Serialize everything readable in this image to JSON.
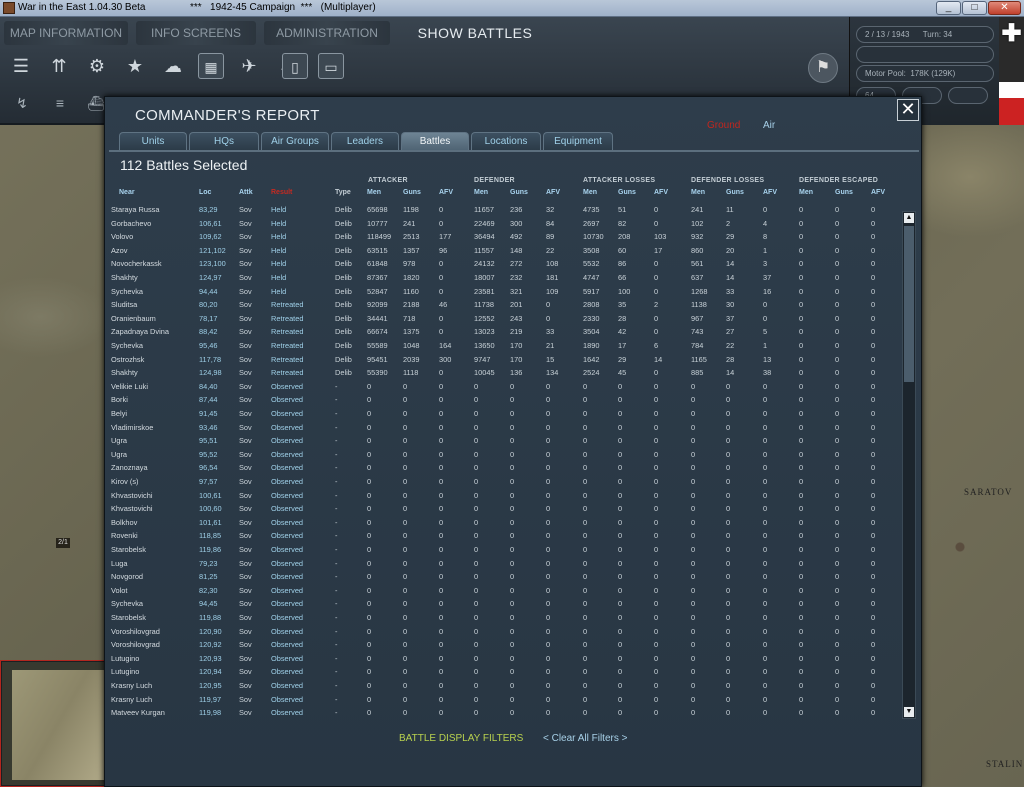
{
  "window": {
    "title": "War in the East 1.04.30 Beta",
    "subtitle": "***   1942-45 Campaign  ***   (Multiplayer)",
    "min": "_",
    "max": "□",
    "close": "✕"
  },
  "nav": {
    "map_information": "MAP INFORMATION",
    "info_screens": "INFO SCREENS",
    "administration": "ADMINISTRATION",
    "show_battles": "SHOW BATTLES"
  },
  "status": {
    "date": "2 / 13 / 1943",
    "turn": "Turn: 34",
    "motor_pool": "Motor Pool:  178K (129K)",
    "speed": "64"
  },
  "map_labels": {
    "saratov": "SARATOV",
    "stalingrad": "STALIN",
    "hex_counter": "2/1"
  },
  "dialog": {
    "title": "COMMANDER'S REPORT",
    "close_icon": "✕",
    "filter_ground": "Ground",
    "filter_air": "Air",
    "tabs": [
      "Units",
      "HQs",
      "Air Groups",
      "Leaders",
      "Battles",
      "Locations",
      "Equipment"
    ],
    "active_tab": "Battles",
    "count_text": "112 Battles Selected",
    "groups": {
      "attacker": "ATTACKER",
      "defender": "DEFENDER",
      "attacker_losses": "ATTACKER LOSSES",
      "defender_losses": "DEFENDER LOSSES",
      "defender_escaped": "DEFENDER ESCAPED"
    },
    "columns": {
      "near": "Near",
      "loc": "Loc",
      "attk": "Attk",
      "result": "Result",
      "type": "Type",
      "men": "Men",
      "guns": "Guns",
      "afv": "AFV"
    },
    "footer_filters": "BATTLE DISPLAY FILTERS",
    "footer_clear": "< Clear All Filters >",
    "colors": {
      "accent_blue": "#9fd0e8",
      "result_red": "#c42a22",
      "filter_green": "#b8d14f"
    }
  },
  "battles": [
    [
      "Staraya Russa",
      "83,29",
      "Sov",
      "Held",
      "Delib",
      "65698",
      "1198",
      "0",
      "11657",
      "236",
      "32",
      "4735",
      "51",
      "0",
      "241",
      "11",
      "0",
      "0",
      "0",
      "0"
    ],
    [
      "Gorbachevo",
      "106,61",
      "Sov",
      "Held",
      "Delib",
      "10777",
      "241",
      "0",
      "22469",
      "300",
      "84",
      "2697",
      "82",
      "0",
      "102",
      "2",
      "4",
      "0",
      "0",
      "0"
    ],
    [
      "Volovo",
      "109,62",
      "Sov",
      "Held",
      "Delib",
      "118499",
      "2513",
      "177",
      "36494",
      "492",
      "89",
      "10730",
      "208",
      "103",
      "932",
      "29",
      "8",
      "0",
      "0",
      "0"
    ],
    [
      "Azov",
      "121,102",
      "Sov",
      "Held",
      "Delib",
      "63515",
      "1357",
      "96",
      "11557",
      "148",
      "22",
      "3508",
      "60",
      "17",
      "860",
      "20",
      "1",
      "0",
      "0",
      "0"
    ],
    [
      "Novocherkassk",
      "123,100",
      "Sov",
      "Held",
      "Delib",
      "61848",
      "978",
      "0",
      "24132",
      "272",
      "108",
      "5532",
      "86",
      "0",
      "561",
      "14",
      "3",
      "0",
      "0",
      "0"
    ],
    [
      "Shakhty",
      "124,97",
      "Sov",
      "Held",
      "Delib",
      "87367",
      "1820",
      "0",
      "18007",
      "232",
      "181",
      "4747",
      "66",
      "0",
      "637",
      "14",
      "37",
      "0",
      "0",
      "0"
    ],
    [
      "Sychevka",
      "94,44",
      "Sov",
      "Held",
      "Delib",
      "52847",
      "1160",
      "0",
      "23581",
      "321",
      "109",
      "5917",
      "100",
      "0",
      "1268",
      "33",
      "16",
      "0",
      "0",
      "0"
    ],
    [
      "Sluditsa",
      "80,20",
      "Sov",
      "Retreated",
      "Delib",
      "92099",
      "2188",
      "46",
      "11738",
      "201",
      "0",
      "2808",
      "35",
      "2",
      "1138",
      "30",
      "0",
      "0",
      "0",
      "0"
    ],
    [
      "Oranienbaum",
      "78,17",
      "Sov",
      "Retreated",
      "Delib",
      "34441",
      "718",
      "0",
      "12552",
      "243",
      "0",
      "2330",
      "28",
      "0",
      "967",
      "37",
      "0",
      "0",
      "0",
      "0"
    ],
    [
      "Zapadnaya Dvina",
      "88,42",
      "Sov",
      "Retreated",
      "Delib",
      "66674",
      "1375",
      "0",
      "13023",
      "219",
      "33",
      "3504",
      "42",
      "0",
      "743",
      "27",
      "5",
      "0",
      "0",
      "0"
    ],
    [
      "Sychevka",
      "95,46",
      "Sov",
      "Retreated",
      "Delib",
      "55589",
      "1048",
      "164",
      "13650",
      "170",
      "21",
      "1890",
      "17",
      "6",
      "784",
      "22",
      "1",
      "0",
      "0",
      "0"
    ],
    [
      "Ostrozhsk",
      "117,78",
      "Sov",
      "Retreated",
      "Delib",
      "95451",
      "2039",
      "300",
      "9747",
      "170",
      "15",
      "1642",
      "29",
      "14",
      "1165",
      "28",
      "13",
      "0",
      "0",
      "0"
    ],
    [
      "Shakhty",
      "124,98",
      "Sov",
      "Retreated",
      "Delib",
      "55390",
      "1118",
      "0",
      "10045",
      "136",
      "134",
      "2524",
      "45",
      "0",
      "885",
      "14",
      "38",
      "0",
      "0",
      "0"
    ],
    [
      "Velikie Luki",
      "84,40",
      "Sov",
      "Observed",
      "-",
      "0",
      "0",
      "0",
      "0",
      "0",
      "0",
      "0",
      "0",
      "0",
      "0",
      "0",
      "0",
      "0",
      "0",
      "0"
    ],
    [
      "Borki",
      "87,44",
      "Sov",
      "Observed",
      "-",
      "0",
      "0",
      "0",
      "0",
      "0",
      "0",
      "0",
      "0",
      "0",
      "0",
      "0",
      "0",
      "0",
      "0",
      "0"
    ],
    [
      "Belyi",
      "91,45",
      "Sov",
      "Observed",
      "-",
      "0",
      "0",
      "0",
      "0",
      "0",
      "0",
      "0",
      "0",
      "0",
      "0",
      "0",
      "0",
      "0",
      "0",
      "0"
    ],
    [
      "Vladimirskoe",
      "93,46",
      "Sov",
      "Observed",
      "-",
      "0",
      "0",
      "0",
      "0",
      "0",
      "0",
      "0",
      "0",
      "0",
      "0",
      "0",
      "0",
      "0",
      "0",
      "0"
    ],
    [
      "Ugra",
      "95,51",
      "Sov",
      "Observed",
      "-",
      "0",
      "0",
      "0",
      "0",
      "0",
      "0",
      "0",
      "0",
      "0",
      "0",
      "0",
      "0",
      "0",
      "0",
      "0"
    ],
    [
      "Ugra",
      "95,52",
      "Sov",
      "Observed",
      "-",
      "0",
      "0",
      "0",
      "0",
      "0",
      "0",
      "0",
      "0",
      "0",
      "0",
      "0",
      "0",
      "0",
      "0",
      "0"
    ],
    [
      "Zanoznaya",
      "96,54",
      "Sov",
      "Observed",
      "-",
      "0",
      "0",
      "0",
      "0",
      "0",
      "0",
      "0",
      "0",
      "0",
      "0",
      "0",
      "0",
      "0",
      "0",
      "0"
    ],
    [
      "Kirov (s)",
      "97,57",
      "Sov",
      "Observed",
      "-",
      "0",
      "0",
      "0",
      "0",
      "0",
      "0",
      "0",
      "0",
      "0",
      "0",
      "0",
      "0",
      "0",
      "0",
      "0"
    ],
    [
      "Khvastovichi",
      "100,61",
      "Sov",
      "Observed",
      "-",
      "0",
      "0",
      "0",
      "0",
      "0",
      "0",
      "0",
      "0",
      "0",
      "0",
      "0",
      "0",
      "0",
      "0",
      "0"
    ],
    [
      "Khvastovichi",
      "100,60",
      "Sov",
      "Observed",
      "-",
      "0",
      "0",
      "0",
      "0",
      "0",
      "0",
      "0",
      "0",
      "0",
      "0",
      "0",
      "0",
      "0",
      "0",
      "0"
    ],
    [
      "Bolkhov",
      "101,61",
      "Sov",
      "Observed",
      "-",
      "0",
      "0",
      "0",
      "0",
      "0",
      "0",
      "0",
      "0",
      "0",
      "0",
      "0",
      "0",
      "0",
      "0",
      "0"
    ],
    [
      "Rovenki",
      "118,85",
      "Sov",
      "Observed",
      "-",
      "0",
      "0",
      "0",
      "0",
      "0",
      "0",
      "0",
      "0",
      "0",
      "0",
      "0",
      "0",
      "0",
      "0",
      "0"
    ],
    [
      "Starobelsk",
      "119,86",
      "Sov",
      "Observed",
      "-",
      "0",
      "0",
      "0",
      "0",
      "0",
      "0",
      "0",
      "0",
      "0",
      "0",
      "0",
      "0",
      "0",
      "0",
      "0"
    ],
    [
      "Luga",
      "79,23",
      "Sov",
      "Observed",
      "-",
      "0",
      "0",
      "0",
      "0",
      "0",
      "0",
      "0",
      "0",
      "0",
      "0",
      "0",
      "0",
      "0",
      "0",
      "0"
    ],
    [
      "Novgorod",
      "81,25",
      "Sov",
      "Observed",
      "-",
      "0",
      "0",
      "0",
      "0",
      "0",
      "0",
      "0",
      "0",
      "0",
      "0",
      "0",
      "0",
      "0",
      "0",
      "0"
    ],
    [
      "Volot",
      "82,30",
      "Sov",
      "Observed",
      "-",
      "0",
      "0",
      "0",
      "0",
      "0",
      "0",
      "0",
      "0",
      "0",
      "0",
      "0",
      "0",
      "0",
      "0",
      "0"
    ],
    [
      "Sychevka",
      "94,45",
      "Sov",
      "Observed",
      "-",
      "0",
      "0",
      "0",
      "0",
      "0",
      "0",
      "0",
      "0",
      "0",
      "0",
      "0",
      "0",
      "0",
      "0",
      "0"
    ],
    [
      "Starobelsk",
      "119,88",
      "Sov",
      "Observed",
      "-",
      "0",
      "0",
      "0",
      "0",
      "0",
      "0",
      "0",
      "0",
      "0",
      "0",
      "0",
      "0",
      "0",
      "0",
      "0"
    ],
    [
      "Voroshilovgrad",
      "120,90",
      "Sov",
      "Observed",
      "-",
      "0",
      "0",
      "0",
      "0",
      "0",
      "0",
      "0",
      "0",
      "0",
      "0",
      "0",
      "0",
      "0",
      "0",
      "0"
    ],
    [
      "Voroshilovgrad",
      "120,92",
      "Sov",
      "Observed",
      "-",
      "0",
      "0",
      "0",
      "0",
      "0",
      "0",
      "0",
      "0",
      "0",
      "0",
      "0",
      "0",
      "0",
      "0",
      "0"
    ],
    [
      "Lutugino",
      "120,93",
      "Sov",
      "Observed",
      "-",
      "0",
      "0",
      "0",
      "0",
      "0",
      "0",
      "0",
      "0",
      "0",
      "0",
      "0",
      "0",
      "0",
      "0",
      "0"
    ],
    [
      "Lutugino",
      "120,94",
      "Sov",
      "Observed",
      "-",
      "0",
      "0",
      "0",
      "0",
      "0",
      "0",
      "0",
      "0",
      "0",
      "0",
      "0",
      "0",
      "0",
      "0",
      "0"
    ],
    [
      "Krasny Luch",
      "120,95",
      "Sov",
      "Observed",
      "-",
      "0",
      "0",
      "0",
      "0",
      "0",
      "0",
      "0",
      "0",
      "0",
      "0",
      "0",
      "0",
      "0",
      "0",
      "0"
    ],
    [
      "Krasny Luch",
      "119,97",
      "Sov",
      "Observed",
      "-",
      "0",
      "0",
      "0",
      "0",
      "0",
      "0",
      "0",
      "0",
      "0",
      "0",
      "0",
      "0",
      "0",
      "0",
      "0"
    ],
    [
      "Matveev Kurgan",
      "119,98",
      "Sov",
      "Observed",
      "-",
      "0",
      "0",
      "0",
      "0",
      "0",
      "0",
      "0",
      "0",
      "0",
      "0",
      "0",
      "0",
      "0",
      "0",
      "0"
    ]
  ]
}
